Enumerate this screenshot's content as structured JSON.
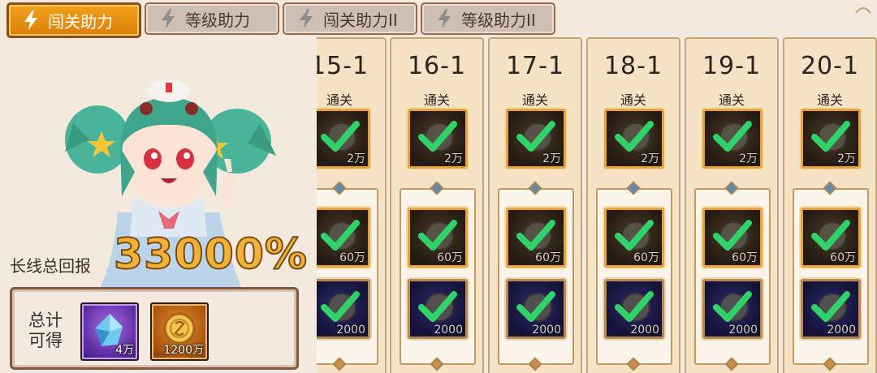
{
  "tabs": [
    {
      "label": "闯关助力",
      "active": true
    },
    {
      "label": "等级助力",
      "active": false
    },
    {
      "label": "闯关助力II",
      "active": false
    },
    {
      "label": "等级助力II",
      "active": false
    }
  ],
  "bonus": {
    "label": "长线总回报",
    "value": "33000%"
  },
  "totals": {
    "label_line1": "总计",
    "label_line2": "可得",
    "rewards": [
      {
        "icon": "crystal-icon",
        "amount": "4万"
      },
      {
        "icon": "gold-coin-icon",
        "amount": "1200万"
      }
    ]
  },
  "columns": [
    {
      "stage": "15-1",
      "status": "通关",
      "rewards": [
        "2万",
        "60万",
        "2000"
      ]
    },
    {
      "stage": "16-1",
      "status": "通关",
      "rewards": [
        "2万",
        "60万",
        "2000"
      ]
    },
    {
      "stage": "17-1",
      "status": "通关",
      "rewards": [
        "2万",
        "60万",
        "2000"
      ]
    },
    {
      "stage": "18-1",
      "status": "通关",
      "rewards": [
        "2万",
        "60万",
        "2000"
      ]
    },
    {
      "stage": "19-1",
      "status": "通关",
      "rewards": [
        "2万",
        "60万",
        "2000"
      ]
    },
    {
      "stage": "20-1",
      "status": "通关",
      "rewards": [
        "2万",
        "60万",
        "2000"
      ]
    }
  ],
  "colors": {
    "accent_orange": "#e58c10",
    "check_green": "#2fd36a",
    "bonus_gold": "#f2b238"
  }
}
